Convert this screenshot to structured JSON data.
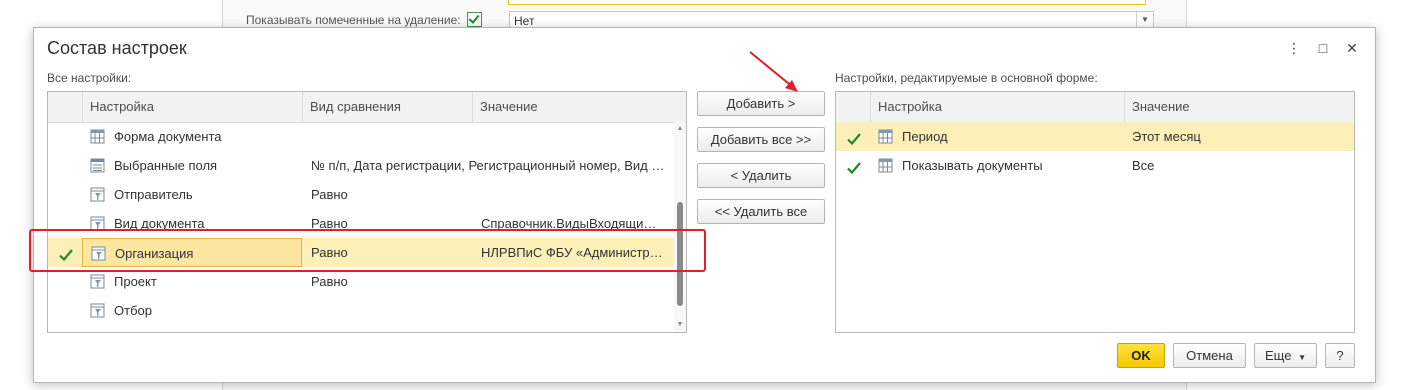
{
  "background": {
    "row_label": "Показывать помеченные на удаление:",
    "select_value": "Нет"
  },
  "dialog": {
    "title": "Состав настроек",
    "title_buttons": [
      "⋮",
      "□",
      "✕"
    ]
  },
  "left": {
    "label": "Все настройки:",
    "columns": [
      "Настройка",
      "Вид сравнения",
      "Значение"
    ],
    "rows": [
      {
        "checked": false,
        "name": "Форма документа",
        "comparison": "",
        "value": "",
        "icon": "settings-table-icon"
      },
      {
        "checked": false,
        "name": "Выбранные поля",
        "comparison": "№ п/п, Дата регистрации, Регистрационный номер, Вид …",
        "value": "",
        "icon": "fields-list-icon"
      },
      {
        "checked": false,
        "name": "Отправитель",
        "comparison": "Равно",
        "value": "",
        "icon": "filter-icon"
      },
      {
        "checked": false,
        "name": "Вид документа",
        "comparison": "Равно",
        "value": "Справочник.ВидыВходящи…",
        "icon": "filter-icon"
      },
      {
        "checked": true,
        "name": "Организация",
        "comparison": "Равно",
        "value": "НЛРВПиС ФБУ «Администр…",
        "icon": "filter-icon",
        "selected": true
      },
      {
        "checked": false,
        "name": "Проект",
        "comparison": "Равно",
        "value": "",
        "icon": "filter-icon"
      },
      {
        "checked": false,
        "name": "Отбор",
        "comparison": "",
        "value": "",
        "icon": "filter-icon"
      }
    ]
  },
  "buttons": {
    "add": "Добавить >",
    "add_all": "Добавить все >>",
    "remove": "< Удалить",
    "remove_all": "<< Удалить все"
  },
  "right": {
    "label": "Настройки, редактируемые в основной форме:",
    "columns": [
      "Настройка",
      "Значение"
    ],
    "rows": [
      {
        "checked": true,
        "name": "Период",
        "value": "Этот месяц",
        "icon": "settings-table-icon",
        "selected": true
      },
      {
        "checked": true,
        "name": "Показывать документы",
        "value": "Все",
        "icon": "settings-table-icon"
      }
    ]
  },
  "footer": {
    "ok": "OK",
    "cancel": "Отмена",
    "more": "Еще",
    "help": "?"
  },
  "colors": {
    "selection": "#fcefb8",
    "ok_button": "#f5c800",
    "check_green": "#1e8a2e",
    "annotation_red": "#e01f2b"
  }
}
